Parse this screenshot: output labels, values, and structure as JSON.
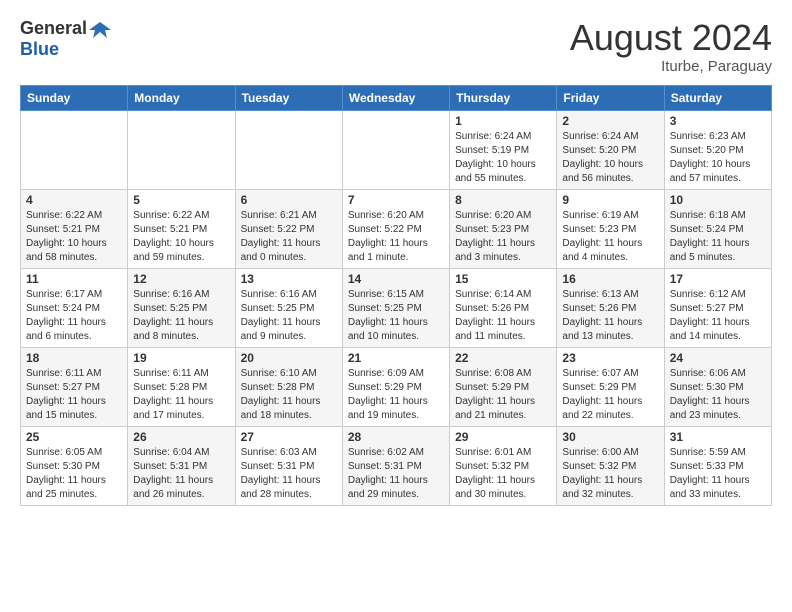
{
  "header": {
    "logo_general": "General",
    "logo_blue": "Blue",
    "month_title": "August 2024",
    "location": "Iturbe, Paraguay"
  },
  "weekdays": [
    "Sunday",
    "Monday",
    "Tuesday",
    "Wednesday",
    "Thursday",
    "Friday",
    "Saturday"
  ],
  "weeks": [
    [
      {
        "day": "",
        "info": "",
        "shaded": false,
        "empty": true
      },
      {
        "day": "",
        "info": "",
        "shaded": false,
        "empty": true
      },
      {
        "day": "",
        "info": "",
        "shaded": false,
        "empty": true
      },
      {
        "day": "",
        "info": "",
        "shaded": false,
        "empty": true
      },
      {
        "day": "1",
        "info": "Sunrise: 6:24 AM\nSunset: 5:19 PM\nDaylight: 10 hours\nand 55 minutes.",
        "shaded": false
      },
      {
        "day": "2",
        "info": "Sunrise: 6:24 AM\nSunset: 5:20 PM\nDaylight: 10 hours\nand 56 minutes.",
        "shaded": true
      },
      {
        "day": "3",
        "info": "Sunrise: 6:23 AM\nSunset: 5:20 PM\nDaylight: 10 hours\nand 57 minutes.",
        "shaded": false
      }
    ],
    [
      {
        "day": "4",
        "info": "Sunrise: 6:22 AM\nSunset: 5:21 PM\nDaylight: 10 hours\nand 58 minutes.",
        "shaded": true
      },
      {
        "day": "5",
        "info": "Sunrise: 6:22 AM\nSunset: 5:21 PM\nDaylight: 10 hours\nand 59 minutes.",
        "shaded": false
      },
      {
        "day": "6",
        "info": "Sunrise: 6:21 AM\nSunset: 5:22 PM\nDaylight: 11 hours\nand 0 minutes.",
        "shaded": true
      },
      {
        "day": "7",
        "info": "Sunrise: 6:20 AM\nSunset: 5:22 PM\nDaylight: 11 hours\nand 1 minute.",
        "shaded": false
      },
      {
        "day": "8",
        "info": "Sunrise: 6:20 AM\nSunset: 5:23 PM\nDaylight: 11 hours\nand 3 minutes.",
        "shaded": true
      },
      {
        "day": "9",
        "info": "Sunrise: 6:19 AM\nSunset: 5:23 PM\nDaylight: 11 hours\nand 4 minutes.",
        "shaded": false
      },
      {
        "day": "10",
        "info": "Sunrise: 6:18 AM\nSunset: 5:24 PM\nDaylight: 11 hours\nand 5 minutes.",
        "shaded": true
      }
    ],
    [
      {
        "day": "11",
        "info": "Sunrise: 6:17 AM\nSunset: 5:24 PM\nDaylight: 11 hours\nand 6 minutes.",
        "shaded": false
      },
      {
        "day": "12",
        "info": "Sunrise: 6:16 AM\nSunset: 5:25 PM\nDaylight: 11 hours\nand 8 minutes.",
        "shaded": true
      },
      {
        "day": "13",
        "info": "Sunrise: 6:16 AM\nSunset: 5:25 PM\nDaylight: 11 hours\nand 9 minutes.",
        "shaded": false
      },
      {
        "day": "14",
        "info": "Sunrise: 6:15 AM\nSunset: 5:25 PM\nDaylight: 11 hours\nand 10 minutes.",
        "shaded": true
      },
      {
        "day": "15",
        "info": "Sunrise: 6:14 AM\nSunset: 5:26 PM\nDaylight: 11 hours\nand 11 minutes.",
        "shaded": false
      },
      {
        "day": "16",
        "info": "Sunrise: 6:13 AM\nSunset: 5:26 PM\nDaylight: 11 hours\nand 13 minutes.",
        "shaded": true
      },
      {
        "day": "17",
        "info": "Sunrise: 6:12 AM\nSunset: 5:27 PM\nDaylight: 11 hours\nand 14 minutes.",
        "shaded": false
      }
    ],
    [
      {
        "day": "18",
        "info": "Sunrise: 6:11 AM\nSunset: 5:27 PM\nDaylight: 11 hours\nand 15 minutes.",
        "shaded": true
      },
      {
        "day": "19",
        "info": "Sunrise: 6:11 AM\nSunset: 5:28 PM\nDaylight: 11 hours\nand 17 minutes.",
        "shaded": false
      },
      {
        "day": "20",
        "info": "Sunrise: 6:10 AM\nSunset: 5:28 PM\nDaylight: 11 hours\nand 18 minutes.",
        "shaded": true
      },
      {
        "day": "21",
        "info": "Sunrise: 6:09 AM\nSunset: 5:29 PM\nDaylight: 11 hours\nand 19 minutes.",
        "shaded": false
      },
      {
        "day": "22",
        "info": "Sunrise: 6:08 AM\nSunset: 5:29 PM\nDaylight: 11 hours\nand 21 minutes.",
        "shaded": true
      },
      {
        "day": "23",
        "info": "Sunrise: 6:07 AM\nSunset: 5:29 PM\nDaylight: 11 hours\nand 22 minutes.",
        "shaded": false
      },
      {
        "day": "24",
        "info": "Sunrise: 6:06 AM\nSunset: 5:30 PM\nDaylight: 11 hours\nand 23 minutes.",
        "shaded": true
      }
    ],
    [
      {
        "day": "25",
        "info": "Sunrise: 6:05 AM\nSunset: 5:30 PM\nDaylight: 11 hours\nand 25 minutes.",
        "shaded": false
      },
      {
        "day": "26",
        "info": "Sunrise: 6:04 AM\nSunset: 5:31 PM\nDaylight: 11 hours\nand 26 minutes.",
        "shaded": true
      },
      {
        "day": "27",
        "info": "Sunrise: 6:03 AM\nSunset: 5:31 PM\nDaylight: 11 hours\nand 28 minutes.",
        "shaded": false
      },
      {
        "day": "28",
        "info": "Sunrise: 6:02 AM\nSunset: 5:31 PM\nDaylight: 11 hours\nand 29 minutes.",
        "shaded": true
      },
      {
        "day": "29",
        "info": "Sunrise: 6:01 AM\nSunset: 5:32 PM\nDaylight: 11 hours\nand 30 minutes.",
        "shaded": false
      },
      {
        "day": "30",
        "info": "Sunrise: 6:00 AM\nSunset: 5:32 PM\nDaylight: 11 hours\nand 32 minutes.",
        "shaded": true
      },
      {
        "day": "31",
        "info": "Sunrise: 5:59 AM\nSunset: 5:33 PM\nDaylight: 11 hours\nand 33 minutes.",
        "shaded": false
      }
    ]
  ]
}
